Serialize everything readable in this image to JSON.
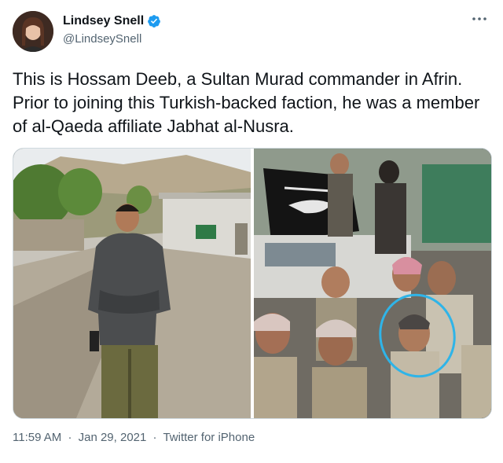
{
  "author": {
    "display_name": "Lindsey Snell",
    "handle": "@LindseySnell",
    "verified_icon": "verified-badge-icon"
  },
  "tweet": {
    "text": "This is Hossam Deeb, a Sultan Murad commander in Afrin. Prior to joining this Turkish-backed faction, he was a member of al-Qaeda affiliate Jabhat al-Nusra."
  },
  "meta": {
    "time": "11:59 AM",
    "separator": "·",
    "date": "Jan 29, 2021",
    "source": "Twitter for iPhone"
  },
  "colors": {
    "verified": "#1d9bf0",
    "text_primary": "#0f1419",
    "text_secondary": "#536471",
    "highlight_circle": "#2fb4e8"
  }
}
